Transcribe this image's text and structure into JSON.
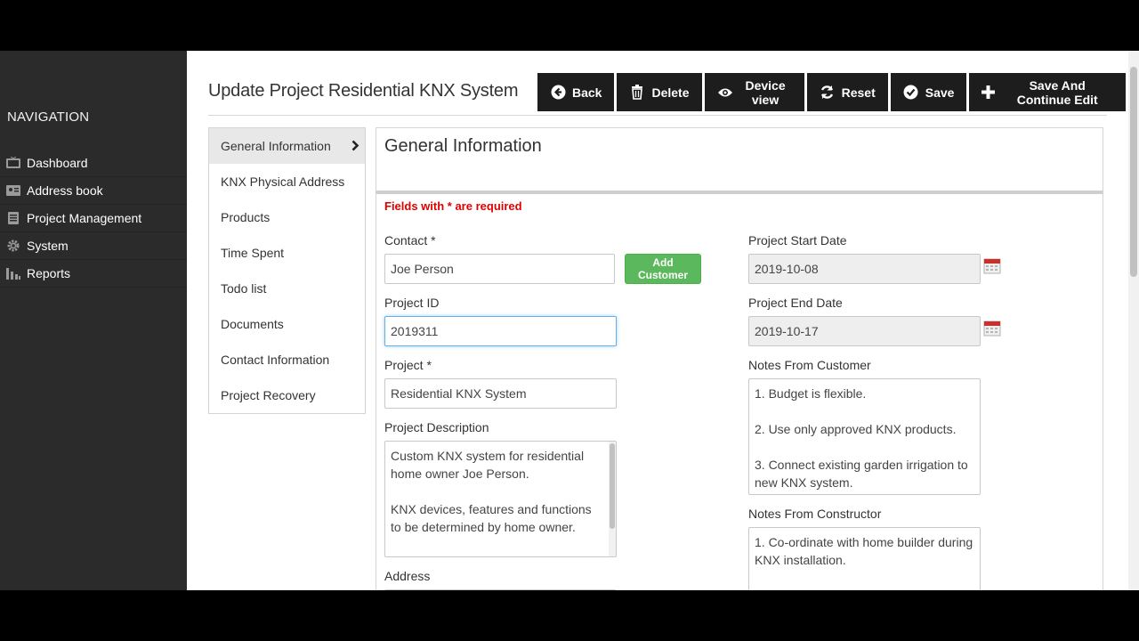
{
  "sidebar": {
    "title": "NAVIGATION",
    "items": [
      {
        "label": "Dashboard",
        "icon": "tv-icon"
      },
      {
        "label": "Address book",
        "icon": "address-book-icon"
      },
      {
        "label": "Project Management",
        "icon": "clipboard-icon"
      },
      {
        "label": "System",
        "icon": "gear-icon"
      },
      {
        "label": "Reports",
        "icon": "bar-chart-icon"
      }
    ]
  },
  "header": {
    "title": "Update Project Residential KNX System"
  },
  "toolbar": {
    "back_label": "Back",
    "delete_label": "Delete",
    "device_view_label": "Device view",
    "reset_label": "Reset",
    "save_label": "Save",
    "save_continue_label": "Save And Continue Edit"
  },
  "tabs": [
    {
      "label": "General Information",
      "active": true
    },
    {
      "label": "KNX Physical Address"
    },
    {
      "label": "Products"
    },
    {
      "label": "Time Spent"
    },
    {
      "label": "Todo list"
    },
    {
      "label": "Documents"
    },
    {
      "label": "Contact Information"
    },
    {
      "label": "Project Recovery"
    }
  ],
  "panel": {
    "title": "General Information",
    "required_note": "Fields with * are required"
  },
  "form": {
    "contact": {
      "label": "Contact *",
      "value": "Joe Person"
    },
    "add_customer_label": "Add Customer",
    "project_id": {
      "label": "Project ID",
      "value": "2019311"
    },
    "project": {
      "label": "Project *",
      "value": "Residential KNX System"
    },
    "project_description": {
      "label": "Project Description",
      "value": "Custom KNX system for residential home owner Joe Person.\n\nKNX devices, features and functions to be determined by home owner."
    },
    "address": {
      "label": "Address"
    },
    "start_date": {
      "label": "Project Start Date",
      "value": "2019-10-08"
    },
    "end_date": {
      "label": "Project End Date",
      "value": "2019-10-17"
    },
    "notes_customer": {
      "label": "Notes From Customer",
      "value": "1. Budget is flexible.\n\n2.  Use only approved KNX products.\n\n3.  Connect existing garden irrigation to new KNX system."
    },
    "notes_constructor": {
      "label": "Notes From Constructor",
      "value": "1.  Co-ordinate with home builder during KNX installation."
    }
  },
  "colors": {
    "sidebar_bg": "#2b2b2b",
    "toolbar_bg": "#1d1d1d",
    "add_button": "#5cb85c",
    "required_text": "#e00000",
    "calendar_icon": "#c9302c"
  }
}
